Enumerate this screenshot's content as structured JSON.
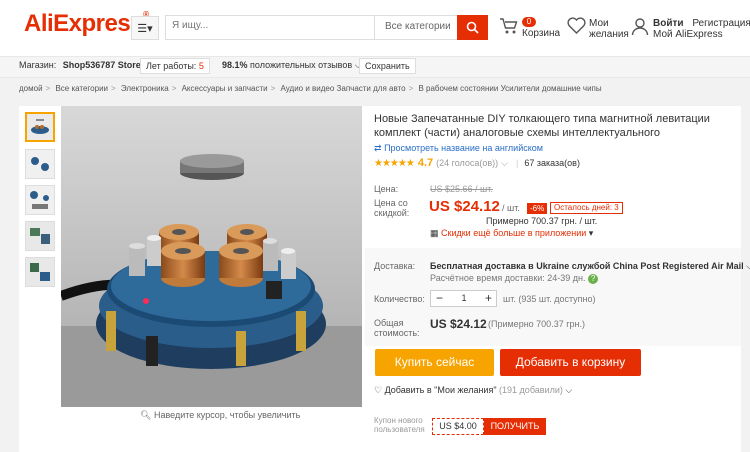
{
  "header": {
    "logo_text": "AliExpress",
    "logo_tm": "®",
    "menu_icon": "hamburger-menu-icon",
    "search_placeholder": "Я ищу...",
    "search_category": "Все категории",
    "cart_count": "0",
    "cart_label": "Корзина",
    "wishlist_label": "Мои желания",
    "login_label": "Войти",
    "register_label": "Регистрация",
    "my_aliexpress_label": "Мой AliExpress",
    "accent_color": "#e62e04"
  },
  "storebar": {
    "store_prefix": "Магазин:",
    "store_name": "Shop536787 Store",
    "years_label": "Лет работы:",
    "years_value": "5",
    "feedback_percent": "98.1%",
    "feedback_label": "положительных отзывов",
    "save_label": "Сохранить"
  },
  "breadcrumbs": [
    "домой",
    "Все категории",
    "Электроника",
    "Аксессуары и запчасти",
    "Аудио и видео Запчасти для авто",
    "В рабочем состоянии Усилители домашние чипы"
  ],
  "gallery": {
    "zoom_hint": "Наведите курсор, чтобы увеличить"
  },
  "product": {
    "title": "Новые Запечатанные DIY толкающего типа магнитной левитации комплект (части) аналоговые схемы интеллектуального",
    "translate_link": "Просмотреть название на английском",
    "rating": 4.7,
    "rating_text": "4.7",
    "votes_text": "(24 голоса(ов))",
    "orders_text": "67 заказа(ов)",
    "price_label": "Цена:",
    "old_price": "US $25.66 / шт.",
    "discount_price_label": "Цена со скидкой:",
    "price": "US $24.12",
    "per_unit": "/ шт.",
    "discount": "-6%",
    "days_left": "Осталось дней: 3",
    "approx_price": "Примерно 700.37 грн. / шт.",
    "app_promo": "Скидки ещё больше в приложении",
    "shipping_label": "Доставка:",
    "shipping_value": "Бесплатная доставка в Ukraine службой China Post Registered Air Mail",
    "shipping_time": "Расчётное время доставки: 24-39 дн.",
    "quantity_label": "Количество:",
    "quantity": "1",
    "quantity_note": "шт. (935 шт. доступно)",
    "total_label": "Общая стоимость:",
    "total_price": "US $24.12",
    "total_approx": "(Примерно 700.37 грн.)",
    "buy_now": "Купить сейчас",
    "add_to_cart": "Добавить в корзину",
    "add_wishlist": "Добавить в \"Мои желания\"",
    "wishlist_count": "(191 добавили)",
    "coupon_label": "Купон нового пользователя",
    "coupon_value": "US $4.00",
    "coupon_button": "ПОЛУЧИТЬ"
  }
}
